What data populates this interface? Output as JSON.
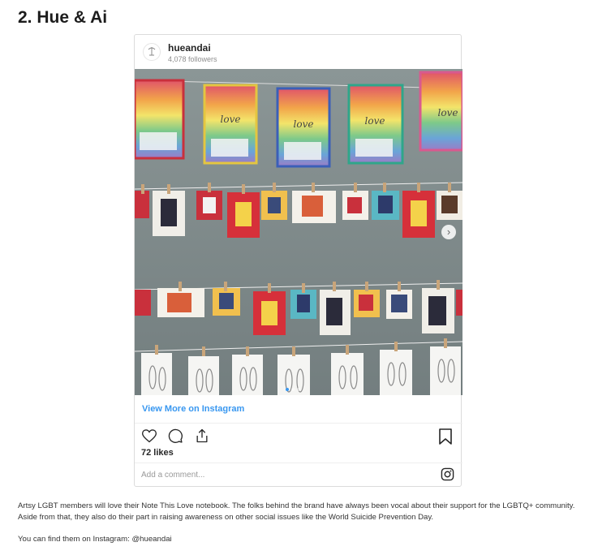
{
  "article": {
    "heading": "2. Hue & Ai",
    "paragraph": "Artsy LGBT members will love their Note This Love notebook. The folks behind the brand have always been vocal about their support for the LGBTQ+ community. Aside from that, they also do their part in raising awareness on other social issues like the World Suicide Prevention Day.",
    "instagram_line": "You can find them on Instagram: @hueandai"
  },
  "embed": {
    "username": "hueandai",
    "followers": "4,078 followers",
    "view_more": "View More on Instagram",
    "likes": "72 likes",
    "comment_placeholder": "Add a comment...",
    "pouch_text": "love",
    "carousel_next": "›",
    "icons": [
      "heart-icon",
      "comment-icon",
      "share-icon",
      "bookmark-icon",
      "instagram-icon",
      "chevron-right-icon"
    ],
    "colors": {
      "link": "#3897f0",
      "muted": "#8e8e8e",
      "wall": "#7f8a8a"
    }
  }
}
